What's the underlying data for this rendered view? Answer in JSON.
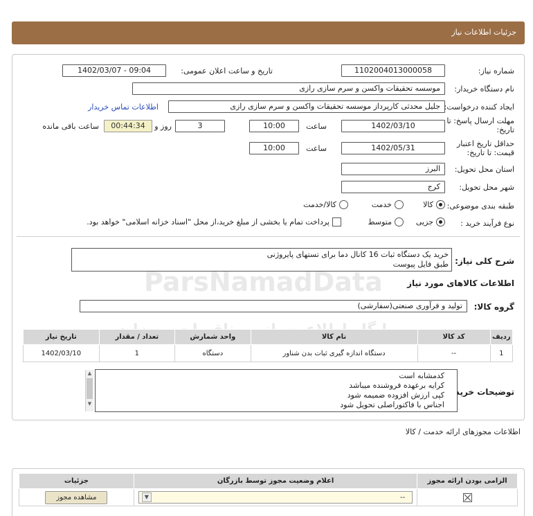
{
  "page_title": "جزئیات اطلاعات نیاز",
  "fields": {
    "need_number_label": "شماره نیاز:",
    "need_number": "1102004013000058",
    "announce_label": "تاریخ و ساعت اعلان عمومی:",
    "announce_value": "1402/03/07 - 09:04",
    "buyer_org_label": "نام دستگاه خریدار:",
    "buyer_org": "موسسه تحقیقات واکسن و سرم سازی رازی",
    "requester_label": "ایجاد کننده درخواست:",
    "requester": "جلیل محدثی کارپرداز موسسه تحقیقات واکسن و سرم سازی رازی",
    "contact_link": "اطلاعات تماس خریدار",
    "deadline_label_1": "مهلت ارسال پاسخ: تا",
    "deadline_label_2": "تاریخ:",
    "deadline_date": "1402/03/10",
    "time_label": "ساعت",
    "deadline_time": "10:00",
    "days_value": "3",
    "days_label": "روز و",
    "remaining_time": "00:44:34",
    "remaining_label": "ساعت باقی مانده",
    "validity_label_1": "حداقل تاریخ اعتبار",
    "validity_label_2": "قیمت: تا تاریخ:",
    "validity_date": "1402/05/31",
    "validity_time": "10:00",
    "province_label": "استان محل تحویل:",
    "province": "البرز",
    "city_label": "شهر محل تحویل:",
    "city": "کرج",
    "category_label": "طبقه بندی موضوعی:",
    "category_options": [
      "کالا",
      "خدمت",
      "کالا/خدمت"
    ],
    "category_selected": "کالا",
    "process_label": "نوع فرآیند خرید :",
    "process_options": [
      "جزیی",
      "متوسط"
    ],
    "process_selected": "جزیی",
    "treasury_note": "پرداخت تمام یا بخشی از مبلغ خرید،از محل \"اسناد خزانه اسلامی\" خواهد بود."
  },
  "summary": {
    "label": "شرح کلی نیاز:",
    "lines": [
      "خرید یک دستگاه ثبات 16 کانال دما برای تستهای پایروژنی",
      "طبق فایل پیوست"
    ]
  },
  "goods_section": {
    "title": "اطلاعات کالاهای مورد نیاز",
    "group_label": "گروه کالا:",
    "group_value": "تولید و فرآوری صنعتی(سفارشی)",
    "columns": [
      "ردیف",
      "کد کالا",
      "نام کالا",
      "واحد شمارش",
      "تعداد / مقدار",
      "تاریخ نیاز"
    ],
    "rows": [
      [
        "1",
        "--",
        "دستگاه اندازه گیری ثبات بدن شناور",
        "دستگاه",
        "1",
        "1402/03/10"
      ]
    ]
  },
  "buyer_notes": {
    "label": "توضیحات خریدار:",
    "lines": [
      "کدمشابه است",
      "کرایه برعهده فروشنده میباشد",
      "کپی ارزش افزوده ضمیمه شود",
      "اجناس با فاکتوراصلی تحویل شود"
    ]
  },
  "permits": {
    "title": "اطلاعات مجوزهای ارائه خدمت / کالا",
    "columns": [
      "الزامی بودن ارائه مجوز",
      "اعلام وضعیت مجوز توسط بازرگان",
      "جزئیات"
    ],
    "status_value": "--",
    "view_button": "مشاهده مجوز"
  },
  "watermark": {
    "line1": "ParsNamadData",
    "line2": "پایگاه اطلاع رسانی مناقصات و مزایده",
    "phone": "۰۲۱-۸۸۳۴۹۶۷۰-۵"
  }
}
